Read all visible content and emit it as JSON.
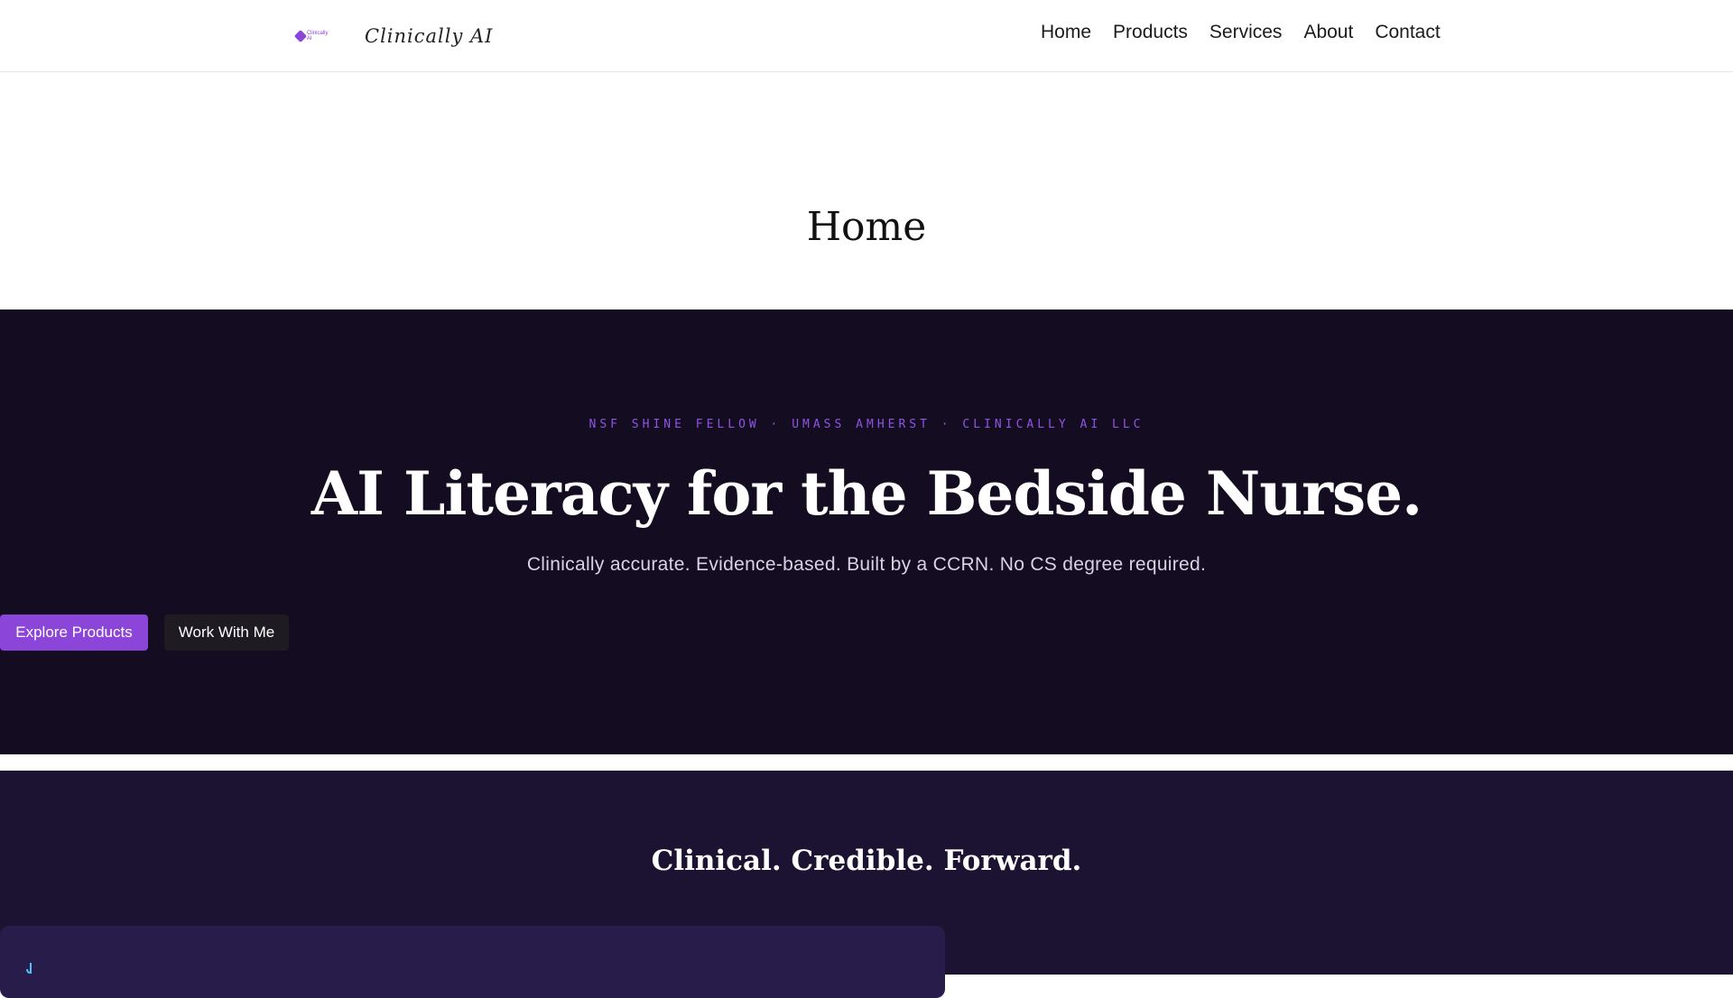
{
  "header": {
    "logo_text": "Clinically AI",
    "brand_name": "Clinically AI",
    "nav": [
      "Home",
      "Products",
      "Services",
      "About",
      "Contact"
    ]
  },
  "page": {
    "title": "Home"
  },
  "hero": {
    "eyebrow": "NSF SHINE FELLOW · UMASS AMHERST · CLINICALLY AI LLC",
    "title": "AI Literacy for the Bedside Nurse.",
    "subtitle": "Clinically accurate. Evidence-based. Built by a CCRN. No CS degree required.",
    "primary_button": "Explore Products",
    "secondary_button": "Work With Me"
  },
  "section2": {
    "title": "Clinical. Credible. Forward."
  },
  "colors": {
    "accent": "#8b45d8",
    "hero_bg": "#140d21",
    "section_bg": "#1c1231",
    "card_bg": "#281d4a"
  },
  "icons": [
    "logo-mark-icon",
    "card-icon"
  ]
}
